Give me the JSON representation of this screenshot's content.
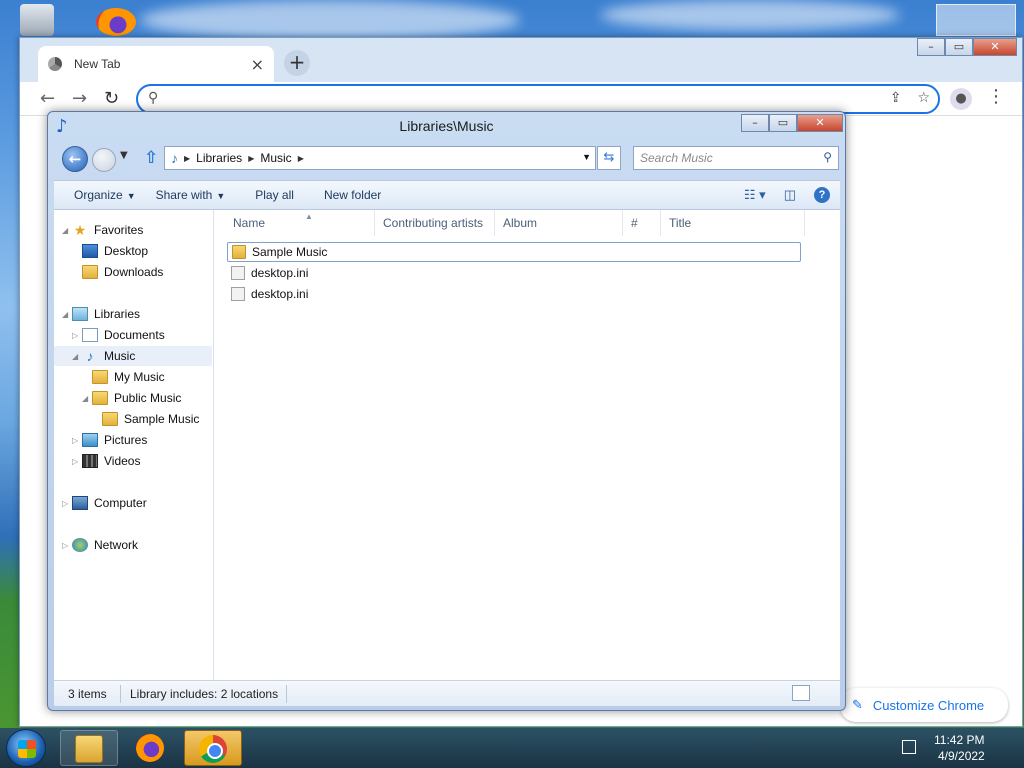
{
  "chrome": {
    "tab_title": "New Tab",
    "tab_close": "×",
    "new_tab": "+",
    "omnibox_value": "",
    "customize_label": "Customize Chrome"
  },
  "explorer": {
    "title": "Libraries\\Music",
    "address": {
      "segments": [
        "Libraries",
        "Music"
      ]
    },
    "search_placeholder": "Search Music",
    "toolbar": {
      "organize": "Organize",
      "share_with": "Share with",
      "play_all": "Play all",
      "new_folder": "New folder"
    },
    "nav": {
      "favorites": "Favorites",
      "desktop": "Desktop",
      "downloads": "Downloads",
      "libraries": "Libraries",
      "documents": "Documents",
      "music": "Music",
      "my_music": "My Music",
      "public_music": "Public Music",
      "sample_music": "Sample Music",
      "pictures": "Pictures",
      "videos": "Videos",
      "computer": "Computer",
      "network": "Network"
    },
    "columns": {
      "name": "Name",
      "contributing_artists": "Contributing artists",
      "album": "Album",
      "number": "#",
      "title": "Title"
    },
    "files": [
      {
        "name": "Sample Music",
        "type": "folder"
      },
      {
        "name": "desktop.ini",
        "type": "ini"
      },
      {
        "name": "desktop.ini",
        "type": "ini"
      }
    ],
    "status": {
      "count": "3 items",
      "library_info": "Library includes: 2 locations"
    }
  },
  "taskbar": {
    "time": "11:42 PM",
    "date": "4/9/2022"
  }
}
